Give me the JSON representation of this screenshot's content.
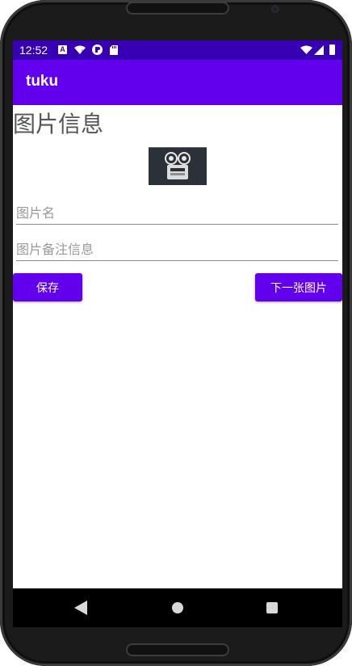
{
  "status_bar": {
    "time": "12:52",
    "icons": [
      "a-notification-icon",
      "wifi-question-icon",
      "circle-app-icon",
      "sd-card-icon",
      "wifi-x-icon",
      "cell-signal-icon",
      "battery-icon"
    ]
  },
  "app_bar": {
    "title": "tuku"
  },
  "page": {
    "heading": "图片信息",
    "image_name_placeholder": "图片名",
    "image_note_placeholder": "图片备注信息",
    "save_label": "保存",
    "next_label": "下一张图片"
  },
  "colors": {
    "status_bar": "#3700b3",
    "primary": "#6200ee",
    "heading_text": "#555555",
    "hint_text": "#9a9a9a"
  }
}
